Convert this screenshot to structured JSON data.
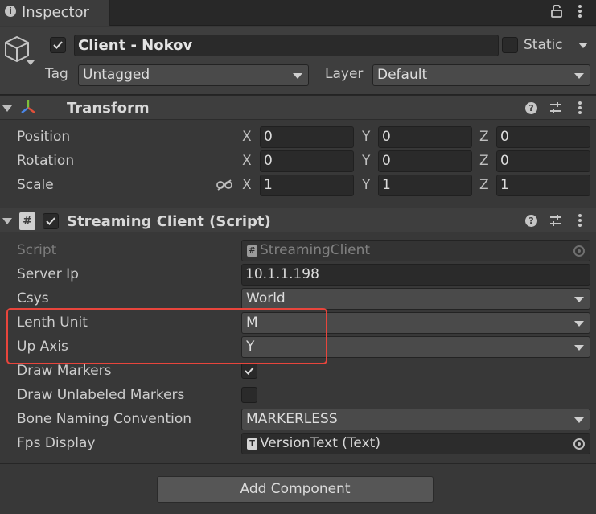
{
  "tab": {
    "icon": "info-icon",
    "label": "Inspector"
  },
  "header": {
    "object_name": "Client - Nokov",
    "active": true,
    "static_label": "Static",
    "static_checked": false,
    "tag_label": "Tag",
    "tag_value": "Untagged",
    "layer_label": "Layer",
    "layer_value": "Default"
  },
  "transform": {
    "title": "Transform",
    "rows": [
      {
        "label": "Position",
        "x": "0",
        "y": "0",
        "z": "0"
      },
      {
        "label": "Rotation",
        "x": "0",
        "y": "0",
        "z": "0"
      },
      {
        "label": "Scale",
        "x": "1",
        "y": "1",
        "z": "1"
      }
    ],
    "axis_labels": [
      "X",
      "Y",
      "Z"
    ]
  },
  "streaming": {
    "title": "Streaming Client (Script)",
    "enabled": true,
    "script_label": "Script",
    "script_value": "StreamingClient",
    "server_ip_label": "Server Ip",
    "server_ip_value": "10.1.1.198",
    "csys_label": "Csys",
    "csys_value": "World",
    "length_unit_label": "Lenth Unit",
    "length_unit_value": "M",
    "up_axis_label": "Up Axis",
    "up_axis_value": "Y",
    "draw_markers_label": "Draw Markers",
    "draw_markers_checked": true,
    "draw_unlabeled_label": "Draw Unlabeled Markers",
    "draw_unlabeled_checked": false,
    "bone_naming_label": "Bone Naming Convention",
    "bone_naming_value": "MARKERLESS",
    "fps_display_label": "Fps Display",
    "fps_display_value": "VersionText (Text)"
  },
  "footer": {
    "add_component_label": "Add Component"
  },
  "colors": {
    "highlight": "#e8453c",
    "panel": "#383838"
  }
}
